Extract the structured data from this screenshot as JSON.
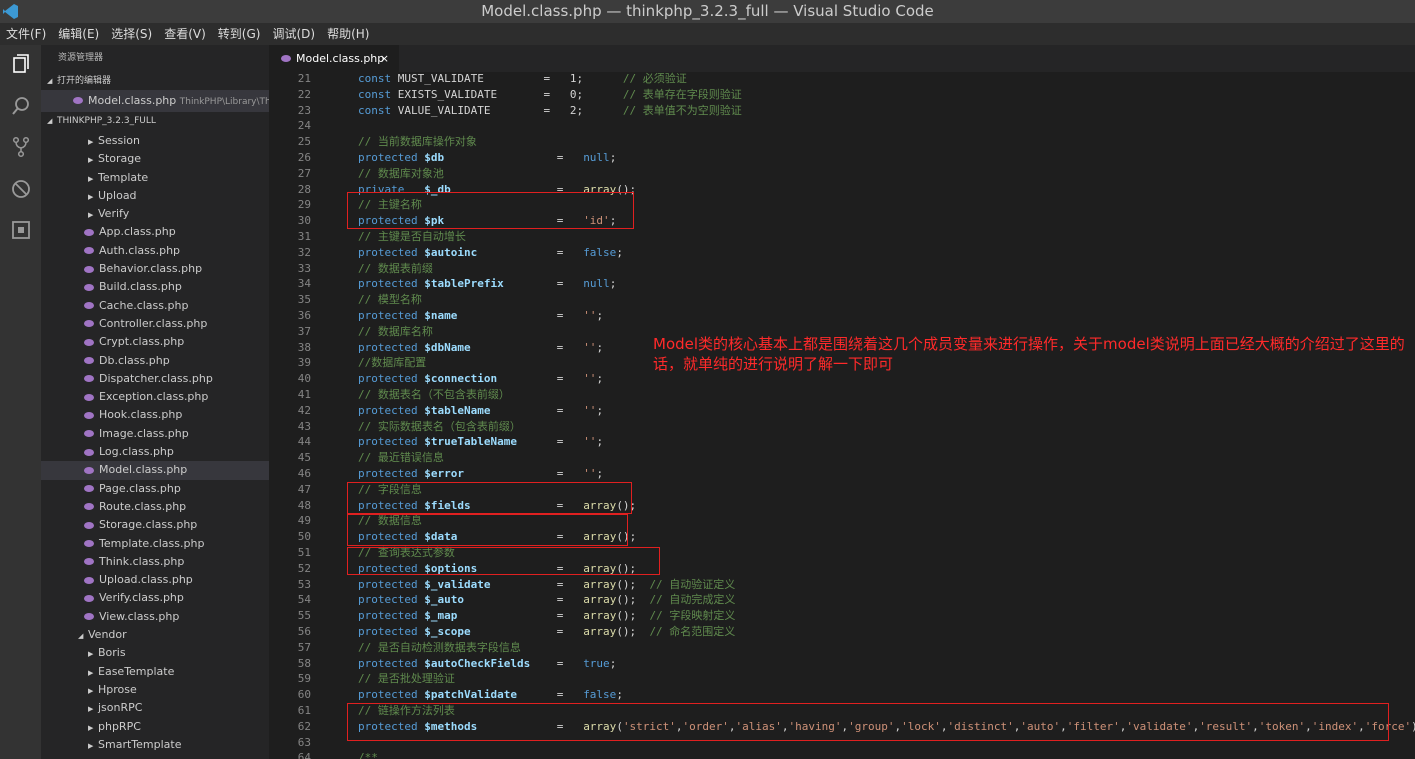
{
  "window": {
    "title": "Model.class.php — thinkphp_3.2.3_full — Visual Studio Code"
  },
  "menu": [
    "文件(F)",
    "编辑(E)",
    "选择(S)",
    "查看(V)",
    "转到(G)",
    "调试(D)",
    "帮助(H)"
  ],
  "sidebar": {
    "title": "资源管理器",
    "open_editors_label": "打开的编辑器",
    "open_file": {
      "name": "Model.class.php",
      "path": "ThinkPHP\\Library\\Thi..."
    },
    "project_label": "THINKPHP_3.2.3_FULL",
    "folders_top": [
      "Session",
      "Storage",
      "Template",
      "Upload",
      "Verify"
    ],
    "files": [
      "App.class.php",
      "Auth.class.php",
      "Behavior.class.php",
      "Build.class.php",
      "Cache.class.php",
      "Controller.class.php",
      "Crypt.class.php",
      "Db.class.php",
      "Dispatcher.class.php",
      "Exception.class.php",
      "Hook.class.php",
      "Image.class.php",
      "Log.class.php",
      "Model.class.php",
      "Page.class.php",
      "Route.class.php",
      "Storage.class.php",
      "Template.class.php",
      "Think.class.php",
      "Upload.class.php",
      "Verify.class.php",
      "View.class.php"
    ],
    "selected_file": "Model.class.php",
    "vendor_label": "Vendor",
    "vendor_folders": [
      "Boris",
      "EaseTemplate",
      "Hprose",
      "jsonRPC",
      "phpRPC",
      "SmartTemplate"
    ]
  },
  "tab": {
    "label": "Model.class.php",
    "close": "×"
  },
  "code_lines": [
    {
      "n": "21",
      "t": [
        [
          "kw",
          "const "
        ],
        [
          "",
          "MUST_VALIDATE         =   1;      "
        ],
        [
          "cm",
          "// 必须验证"
        ]
      ]
    },
    {
      "n": "22",
      "t": [
        [
          "kw",
          "const "
        ],
        [
          "",
          "EXISTS_VALIDATE       =   0;      "
        ],
        [
          "cm",
          "// 表单存在字段则验证"
        ]
      ]
    },
    {
      "n": "23",
      "t": [
        [
          "kw",
          "const "
        ],
        [
          "",
          "VALUE_VALIDATE        =   2;      "
        ],
        [
          "cm",
          "// 表单值不为空则验证"
        ]
      ]
    },
    {
      "n": "24",
      "t": []
    },
    {
      "n": "25",
      "t": [
        [
          "cm",
          "// 当前数据库操作对象"
        ]
      ]
    },
    {
      "n": "26",
      "t": [
        [
          "kw",
          "protected "
        ],
        [
          "var",
          "$db"
        ],
        [
          "",
          "                 =   "
        ],
        [
          "kw",
          "null"
        ],
        [
          "",
          ";"
        ]
      ]
    },
    {
      "n": "27",
      "t": [
        [
          "cm",
          "// 数据库对象池"
        ]
      ]
    },
    {
      "n": "28",
      "t": [
        [
          "kw",
          "private   "
        ],
        [
          "var",
          "$_db"
        ],
        [
          "",
          "                =   "
        ],
        [
          "fn",
          "array"
        ],
        [
          "",
          "();"
        ]
      ]
    },
    {
      "n": "29",
      "t": [
        [
          "cm",
          "// 主键名称"
        ]
      ]
    },
    {
      "n": "30",
      "t": [
        [
          "kw",
          "protected "
        ],
        [
          "var",
          "$pk"
        ],
        [
          "",
          "                 =   "
        ],
        [
          "str",
          "'id'"
        ],
        [
          "",
          ";"
        ]
      ]
    },
    {
      "n": "31",
      "t": [
        [
          "cm",
          "// 主键是否自动增长"
        ]
      ]
    },
    {
      "n": "32",
      "t": [
        [
          "kw",
          "protected "
        ],
        [
          "var",
          "$autoinc"
        ],
        [
          "",
          "            =   "
        ],
        [
          "kw",
          "false"
        ],
        [
          "",
          ";"
        ]
      ]
    },
    {
      "n": "33",
      "t": [
        [
          "cm",
          "// 数据表前缀"
        ]
      ]
    },
    {
      "n": "34",
      "t": [
        [
          "kw",
          "protected "
        ],
        [
          "var",
          "$tablePrefix"
        ],
        [
          "",
          "        =   "
        ],
        [
          "kw",
          "null"
        ],
        [
          "",
          ";"
        ]
      ]
    },
    {
      "n": "35",
      "t": [
        [
          "cm",
          "// 模型名称"
        ]
      ]
    },
    {
      "n": "36",
      "t": [
        [
          "kw",
          "protected "
        ],
        [
          "var",
          "$name"
        ],
        [
          "",
          "               =   "
        ],
        [
          "str",
          "''"
        ],
        [
          "",
          ";"
        ]
      ]
    },
    {
      "n": "37",
      "t": [
        [
          "cm",
          "// 数据库名称"
        ]
      ]
    },
    {
      "n": "38",
      "t": [
        [
          "kw",
          "protected "
        ],
        [
          "var",
          "$dbName"
        ],
        [
          "",
          "             =   "
        ],
        [
          "str",
          "''"
        ],
        [
          "",
          ";"
        ]
      ]
    },
    {
      "n": "39",
      "t": [
        [
          "cm",
          "//数据库配置"
        ]
      ]
    },
    {
      "n": "40",
      "t": [
        [
          "kw",
          "protected "
        ],
        [
          "var",
          "$connection"
        ],
        [
          "",
          "         =   "
        ],
        [
          "str",
          "''"
        ],
        [
          "",
          ";"
        ]
      ]
    },
    {
      "n": "41",
      "t": [
        [
          "cm",
          "// 数据表名（不包含表前缀）"
        ]
      ]
    },
    {
      "n": "42",
      "t": [
        [
          "kw",
          "protected "
        ],
        [
          "var",
          "$tableName"
        ],
        [
          "",
          "          =   "
        ],
        [
          "str",
          "''"
        ],
        [
          "",
          ";"
        ]
      ]
    },
    {
      "n": "43",
      "t": [
        [
          "cm",
          "// 实际数据表名（包含表前缀）"
        ]
      ]
    },
    {
      "n": "44",
      "t": [
        [
          "kw",
          "protected "
        ],
        [
          "var",
          "$trueTableName"
        ],
        [
          "",
          "      =   "
        ],
        [
          "str",
          "''"
        ],
        [
          "",
          ";"
        ]
      ]
    },
    {
      "n": "45",
      "t": [
        [
          "cm",
          "// 最近错误信息"
        ]
      ]
    },
    {
      "n": "46",
      "t": [
        [
          "kw",
          "protected "
        ],
        [
          "var",
          "$error"
        ],
        [
          "",
          "              =   "
        ],
        [
          "str",
          "''"
        ],
        [
          "",
          ";"
        ]
      ]
    },
    {
      "n": "47",
      "t": [
        [
          "cm",
          "// 字段信息"
        ]
      ]
    },
    {
      "n": "48",
      "t": [
        [
          "kw",
          "protected "
        ],
        [
          "var",
          "$fields"
        ],
        [
          "",
          "             =   "
        ],
        [
          "fn",
          "array"
        ],
        [
          "",
          "();"
        ]
      ]
    },
    {
      "n": "49",
      "t": [
        [
          "cm",
          "// 数据信息"
        ]
      ]
    },
    {
      "n": "50",
      "t": [
        [
          "kw",
          "protected "
        ],
        [
          "var",
          "$data"
        ],
        [
          "",
          "               =   "
        ],
        [
          "fn",
          "array"
        ],
        [
          "",
          "();"
        ]
      ]
    },
    {
      "n": "51",
      "t": [
        [
          "cm",
          "// 查询表达式参数"
        ]
      ]
    },
    {
      "n": "52",
      "t": [
        [
          "kw",
          "protected "
        ],
        [
          "var",
          "$options"
        ],
        [
          "",
          "            =   "
        ],
        [
          "fn",
          "array"
        ],
        [
          "",
          "();"
        ]
      ]
    },
    {
      "n": "53",
      "t": [
        [
          "kw",
          "protected "
        ],
        [
          "var",
          "$_validate"
        ],
        [
          "",
          "          =   "
        ],
        [
          "fn",
          "array"
        ],
        [
          "",
          "();  "
        ],
        [
          "cm",
          "// 自动验证定义"
        ]
      ]
    },
    {
      "n": "54",
      "t": [
        [
          "kw",
          "protected "
        ],
        [
          "var",
          "$_auto"
        ],
        [
          "",
          "              =   "
        ],
        [
          "fn",
          "array"
        ],
        [
          "",
          "();  "
        ],
        [
          "cm",
          "// 自动完成定义"
        ]
      ]
    },
    {
      "n": "55",
      "t": [
        [
          "kw",
          "protected "
        ],
        [
          "var",
          "$_map"
        ],
        [
          "",
          "               =   "
        ],
        [
          "fn",
          "array"
        ],
        [
          "",
          "();  "
        ],
        [
          "cm",
          "// 字段映射定义"
        ]
      ]
    },
    {
      "n": "56",
      "t": [
        [
          "kw",
          "protected "
        ],
        [
          "var",
          "$_scope"
        ],
        [
          "",
          "             =   "
        ],
        [
          "fn",
          "array"
        ],
        [
          "",
          "();  "
        ],
        [
          "cm",
          "// 命名范围定义"
        ]
      ]
    },
    {
      "n": "57",
      "t": [
        [
          "cm",
          "// 是否自动检测数据表字段信息"
        ]
      ]
    },
    {
      "n": "58",
      "t": [
        [
          "kw",
          "protected "
        ],
        [
          "var",
          "$autoCheckFields"
        ],
        [
          "",
          "    =   "
        ],
        [
          "kw",
          "true"
        ],
        [
          "",
          ";"
        ]
      ]
    },
    {
      "n": "59",
      "t": [
        [
          "cm",
          "// 是否批处理验证"
        ]
      ]
    },
    {
      "n": "60",
      "t": [
        [
          "kw",
          "protected "
        ],
        [
          "var",
          "$patchValidate"
        ],
        [
          "",
          "      =   "
        ],
        [
          "kw",
          "false"
        ],
        [
          "",
          ";"
        ]
      ]
    },
    {
      "n": "61",
      "t": [
        [
          "cm",
          "// 链操作方法列表"
        ]
      ]
    },
    {
      "n": "62",
      "t": [
        [
          "kw",
          "protected "
        ],
        [
          "var",
          "$methods"
        ],
        [
          "",
          "            =   "
        ],
        [
          "fn",
          "array"
        ],
        [
          "",
          "("
        ],
        [
          "str",
          "'strict'"
        ],
        [
          "",
          ","
        ],
        [
          "str",
          "'order'"
        ],
        [
          "",
          ","
        ],
        [
          "str",
          "'alias'"
        ],
        [
          "",
          ","
        ],
        [
          "str",
          "'having'"
        ],
        [
          "",
          ","
        ],
        [
          "str",
          "'group'"
        ],
        [
          "",
          ","
        ],
        [
          "str",
          "'lock'"
        ],
        [
          "",
          ","
        ],
        [
          "str",
          "'distinct'"
        ],
        [
          "",
          ","
        ],
        [
          "str",
          "'auto'"
        ],
        [
          "",
          ","
        ],
        [
          "str",
          "'filter'"
        ],
        [
          "",
          ","
        ],
        [
          "str",
          "'validate'"
        ],
        [
          "",
          ","
        ],
        [
          "str",
          "'result'"
        ],
        [
          "",
          ","
        ],
        [
          "str",
          "'token'"
        ],
        [
          "",
          ","
        ],
        [
          "str",
          "'index'"
        ],
        [
          "",
          ","
        ],
        [
          "str",
          "'force'"
        ],
        [
          "",
          ");"
        ]
      ]
    },
    {
      "n": "63",
      "t": []
    },
    {
      "n": "64",
      "t": [
        [
          "cm",
          "/**"
        ]
      ]
    }
  ],
  "annotation": "Model类的核心基本上都是围绕着这几个成员变量来进行操作，关于model类说明上面已经大概的介绍过了这里的话，就单纯的进行说明了解一下即可"
}
